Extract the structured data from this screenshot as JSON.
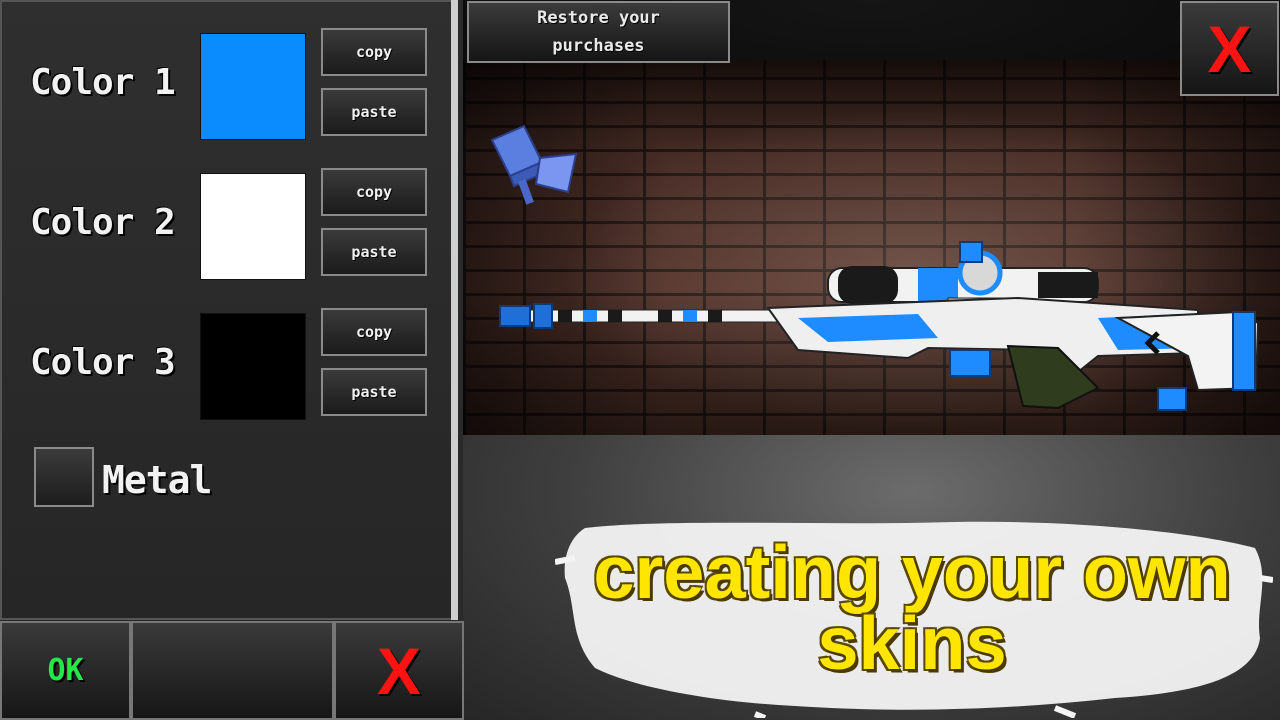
{
  "panel": {
    "colors": [
      {
        "label": "Color 1",
        "swatch": "#0a8cff",
        "copy_label": "copy",
        "paste_label": "paste"
      },
      {
        "label": "Color 2",
        "swatch": "#ffffff",
        "copy_label": "copy",
        "paste_label": "paste"
      },
      {
        "label": "Color 3",
        "swatch": "#000000",
        "copy_label": "copy",
        "paste_label": "paste"
      }
    ],
    "metal_label": "Metal",
    "metal_checked": false
  },
  "bottom_bar": {
    "ok_label": "OK",
    "cancel_label": "X"
  },
  "top": {
    "restore_label": "Restore your\npurchases",
    "close_label": "X"
  },
  "banner": {
    "line1": "creating your own",
    "line2": "skins"
  },
  "icons": [
    "camera-icon",
    "close-icon",
    "rifle-model"
  ],
  "colors": {
    "accent_yellow": "#ffe600",
    "ok_green": "#22e84a",
    "close_red": "#ff1212",
    "skin_blue": "#0a8cff"
  }
}
